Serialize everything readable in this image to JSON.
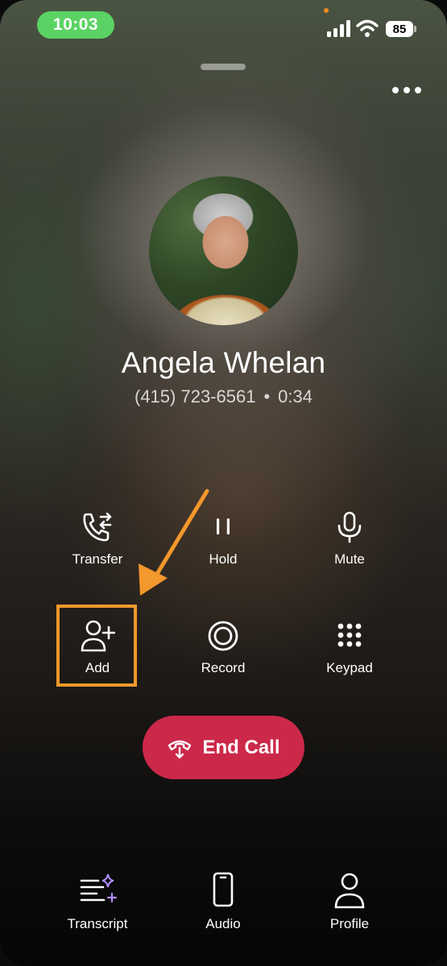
{
  "status_bar": {
    "time": "10:03",
    "battery": "85",
    "icons": [
      "signal-icon",
      "wifi-icon",
      "battery-icon"
    ]
  },
  "header": {
    "more_icon": "ellipsis-icon"
  },
  "contact": {
    "name": "Angela Whelan",
    "phone": "(415) 723-6561",
    "separator": "•",
    "duration": "0:34"
  },
  "actions": {
    "transfer": "Transfer",
    "hold": "Hold",
    "mute": "Mute",
    "add": "Add",
    "record": "Record",
    "keypad": "Keypad"
  },
  "end_call": {
    "label": "End Call",
    "color": "#cc2849"
  },
  "bottom_nav": {
    "transcript": "Transcript",
    "audio": "Audio",
    "profile": "Profile"
  },
  "colors": {
    "time_pill": "#5bd364",
    "highlight": "#f2982c",
    "sparkle": "#b08cff"
  }
}
